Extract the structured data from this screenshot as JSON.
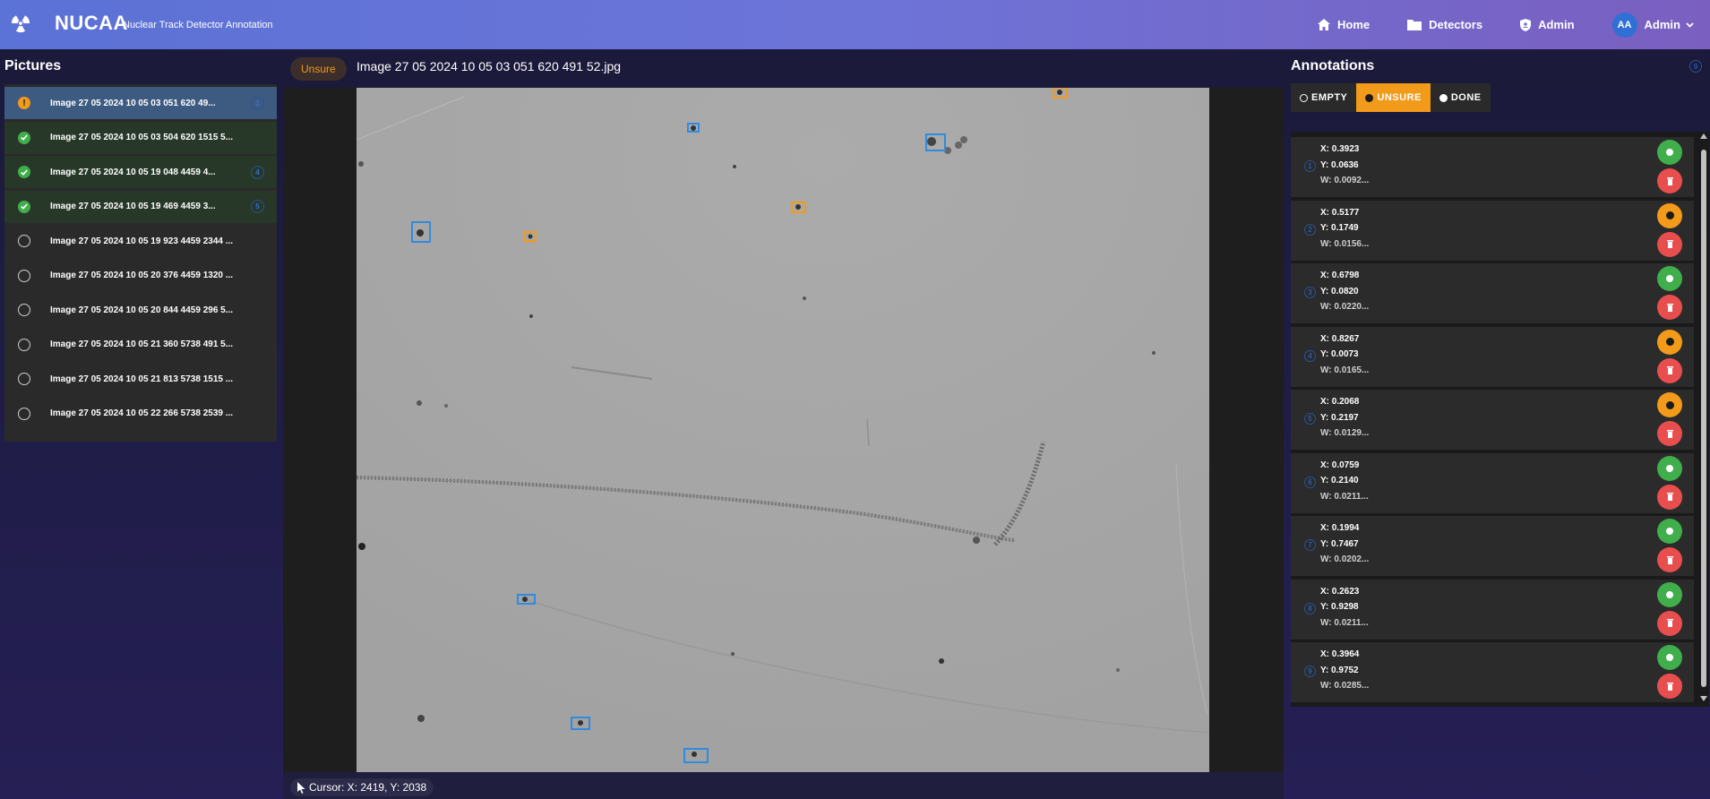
{
  "header": {
    "brand": "NUCAA",
    "subtitle": "Nuclear Track Detector Annotation",
    "nav": [
      {
        "label": "Home",
        "icon": "home-icon"
      },
      {
        "label": "Detectors",
        "icon": "folder-icon"
      },
      {
        "label": "Admin",
        "icon": "shield-icon"
      }
    ],
    "user": {
      "initials": "AA",
      "name": "Admin"
    }
  },
  "pictures": {
    "title": "Pictures",
    "items": [
      {
        "name": "Image 27 05 2024 10 05 03 051 620 49...",
        "status": "unsure",
        "badge": "1"
      },
      {
        "name": "Image 27 05 2024 10 05 03 504 620 1515 5...",
        "status": "done",
        "badge": ""
      },
      {
        "name": "Image 27 05 2024 10 05 19 048 4459 4...",
        "status": "done",
        "badge": "4"
      },
      {
        "name": "Image 27 05 2024 10 05 19 469 4459 3...",
        "status": "done",
        "badge": "5"
      },
      {
        "name": "Image 27 05 2024 10 05 19 923 4459 2344 ...",
        "status": "empty",
        "badge": ""
      },
      {
        "name": "Image 27 05 2024 10 05 20 376 4459 1320 ...",
        "status": "empty",
        "badge": ""
      },
      {
        "name": "Image 27 05 2024 10 05 20 844 4459 296 5...",
        "status": "empty",
        "badge": ""
      },
      {
        "name": "Image 27 05 2024 10 05 21 360 5738 491 5...",
        "status": "empty",
        "badge": ""
      },
      {
        "name": "Image 27 05 2024 10 05 21 813 5738 1515 ...",
        "status": "empty",
        "badge": ""
      },
      {
        "name": "Image 27 05 2024 10 05 22 266 5738 2539 ...",
        "status": "empty",
        "badge": ""
      }
    ]
  },
  "viewer": {
    "status_chip": "Unsure",
    "image_title": "Image 27 05 2024 10 05 03 051 620 491 52.jpg",
    "cursor_text": "Cursor: X: 2419, Y: 2038"
  },
  "annotations": {
    "title": "Annotations",
    "count": "9",
    "filters": [
      {
        "label": "EMPTY",
        "active": false
      },
      {
        "label": "UNSURE",
        "active": true
      },
      {
        "label": "DONE",
        "active": false
      }
    ],
    "items": [
      {
        "num": "1",
        "x": "X: 0.3923",
        "y": "Y: 0.0636",
        "w": "W: 0.0092...",
        "status": "done"
      },
      {
        "num": "2",
        "x": "X: 0.5177",
        "y": "Y: 0.1749",
        "w": "W: 0.0156...",
        "status": "unsure"
      },
      {
        "num": "3",
        "x": "X: 0.6798",
        "y": "Y: 0.0820",
        "w": "W: 0.0220...",
        "status": "done"
      },
      {
        "num": "4",
        "x": "X: 0.8267",
        "y": "Y: 0.0073",
        "w": "W: 0.0165...",
        "status": "unsure"
      },
      {
        "num": "5",
        "x": "X: 0.2068",
        "y": "Y: 0.2197",
        "w": "W: 0.0129...",
        "status": "unsure"
      },
      {
        "num": "6",
        "x": "X: 0.0759",
        "y": "Y: 0.2140",
        "w": "W: 0.0211...",
        "status": "done"
      },
      {
        "num": "7",
        "x": "X: 0.1994",
        "y": "Y: 0.7467",
        "w": "W: 0.0202...",
        "status": "done"
      },
      {
        "num": "8",
        "x": "X: 0.2623",
        "y": "Y: 0.9298",
        "w": "W: 0.0211...",
        "status": "done"
      },
      {
        "num": "9",
        "x": "X: 0.3964",
        "y": "Y: 0.9752",
        "w": "W: 0.0285...",
        "status": "done"
      }
    ]
  },
  "colors": {
    "accent_orange": "#f29a19",
    "done_green": "#3fae4b",
    "delete_red": "#e94e4e",
    "box_blue": "#2f8be0"
  }
}
